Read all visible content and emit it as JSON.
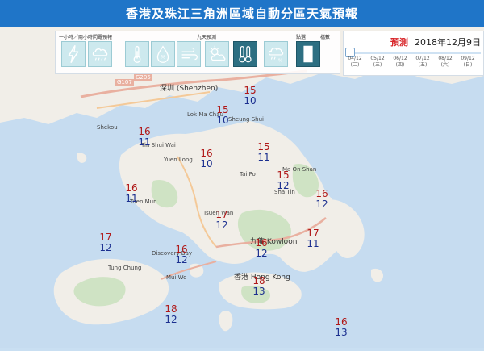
{
  "title": "香港及珠江三角洲區域自動分區天氣預報",
  "toolbar": {
    "group1_label": "一小時／兩小時閃電預報",
    "group2_label": "九天預測",
    "group3_label": "點選",
    "group4_label": "檔數",
    "buttons": [
      {
        "icon": "lightning-icon"
      },
      {
        "icon": "rain-cloud-icon"
      },
      {
        "icon": "thermometer-icon"
      },
      {
        "icon": "humidity-icon"
      },
      {
        "icon": "wind-icon"
      },
      {
        "icon": "sun-cloud-icon"
      },
      {
        "icon": "temperature-range-icon",
        "active": true
      },
      {
        "icon": "rain-probability-icon"
      },
      {
        "icon": "white-panel-icon"
      }
    ]
  },
  "date_panel": {
    "forecast_label": "預測",
    "date": "2018年12月9日",
    "ticks": [
      {
        "date": "04/12",
        "day": "(二)"
      },
      {
        "date": "05/12",
        "day": "(三)"
      },
      {
        "date": "06/12",
        "day": "(四)"
      },
      {
        "date": "07/12",
        "day": "(五)"
      },
      {
        "date": "08/12",
        "day": "(六)"
      },
      {
        "date": "09/12",
        "day": "(日)"
      }
    ]
  },
  "map": {
    "places": [
      {
        "name": "深圳 (Shenzhen)"
      },
      {
        "name": "Shekou"
      },
      {
        "name": "Lok Ma Chau"
      },
      {
        "name": "Sheung Shui"
      },
      {
        "name": "Tin Shui Wai"
      },
      {
        "name": "Yuen Long"
      },
      {
        "name": "Tuen Mun"
      },
      {
        "name": "Tai Po"
      },
      {
        "name": "Ma On Shan"
      },
      {
        "name": "Sha Tin"
      },
      {
        "name": "Tsuen Wan"
      },
      {
        "name": "Tung Chung"
      },
      {
        "name": "Discovery Bay"
      },
      {
        "name": "Mui Wo"
      },
      {
        "name": "九龍 Kowloon"
      },
      {
        "name": "香港 Hong Kong"
      },
      {
        "name": "G107"
      },
      {
        "name": "G205"
      }
    ],
    "temperatures": [
      {
        "high": "15",
        "low": "10"
      },
      {
        "high": "15",
        "low": "10"
      },
      {
        "high": "16",
        "low": "11"
      },
      {
        "high": "16",
        "low": "10"
      },
      {
        "high": "15",
        "low": "11"
      },
      {
        "high": "15",
        "low": "12"
      },
      {
        "high": "16",
        "low": "11"
      },
      {
        "high": "16",
        "low": "12"
      },
      {
        "high": "17",
        "low": "12"
      },
      {
        "high": "17",
        "low": "11"
      },
      {
        "high": "16",
        "low": "12"
      },
      {
        "high": "17",
        "low": "12"
      },
      {
        "high": "16",
        "low": "12"
      },
      {
        "high": "18",
        "low": "13"
      },
      {
        "high": "18",
        "low": "12"
      },
      {
        "high": "16",
        "low": "13"
      }
    ]
  }
}
